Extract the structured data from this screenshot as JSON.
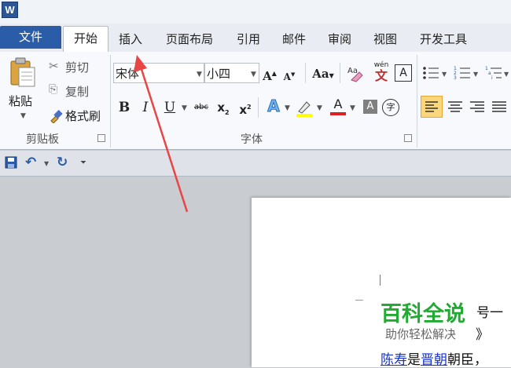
{
  "app": {
    "icon_letter": "W"
  },
  "tabs": [
    {
      "label": "文件"
    },
    {
      "label": "开始"
    },
    {
      "label": "插入"
    },
    {
      "label": "页面布局"
    },
    {
      "label": "引用"
    },
    {
      "label": "邮件"
    },
    {
      "label": "审阅"
    },
    {
      "label": "视图"
    },
    {
      "label": "开发工具"
    }
  ],
  "clipboard": {
    "paste": "粘贴",
    "cut": "剪切",
    "copy": "复制",
    "format_painter": "格式刷",
    "group_label": "剪贴板"
  },
  "font": {
    "font_name": "宋体",
    "font_size": "小四",
    "grow": "A",
    "shrink": "A",
    "change_case": "Aa",
    "phonetic": "wén",
    "phonetic_char": "文",
    "char_border": "A",
    "bold": "B",
    "italic": "I",
    "underline": "U",
    "strike": "abc",
    "subscript": "x",
    "superscript": "x",
    "text_effect": "A",
    "font_color": "A",
    "char_shading": "A",
    "enclose": "字",
    "group_label": "字体"
  },
  "colors": {
    "file_tab": "#2a5ca8",
    "highlight": "#ffff00",
    "font_color": "#e02020",
    "watermark_green": "#22aa33",
    "link": "#1a33cc",
    "arrow": "#e84545"
  },
  "document": {
    "watermark_title": "百科全说",
    "watermark_sub": "助你轻松解决",
    "line1_tail": "号一",
    "line2_tail": "》",
    "line3_link1": "陈寿",
    "line3_mid": "是",
    "line3_link2": "晋朝",
    "line3_tail": "朝臣，"
  }
}
